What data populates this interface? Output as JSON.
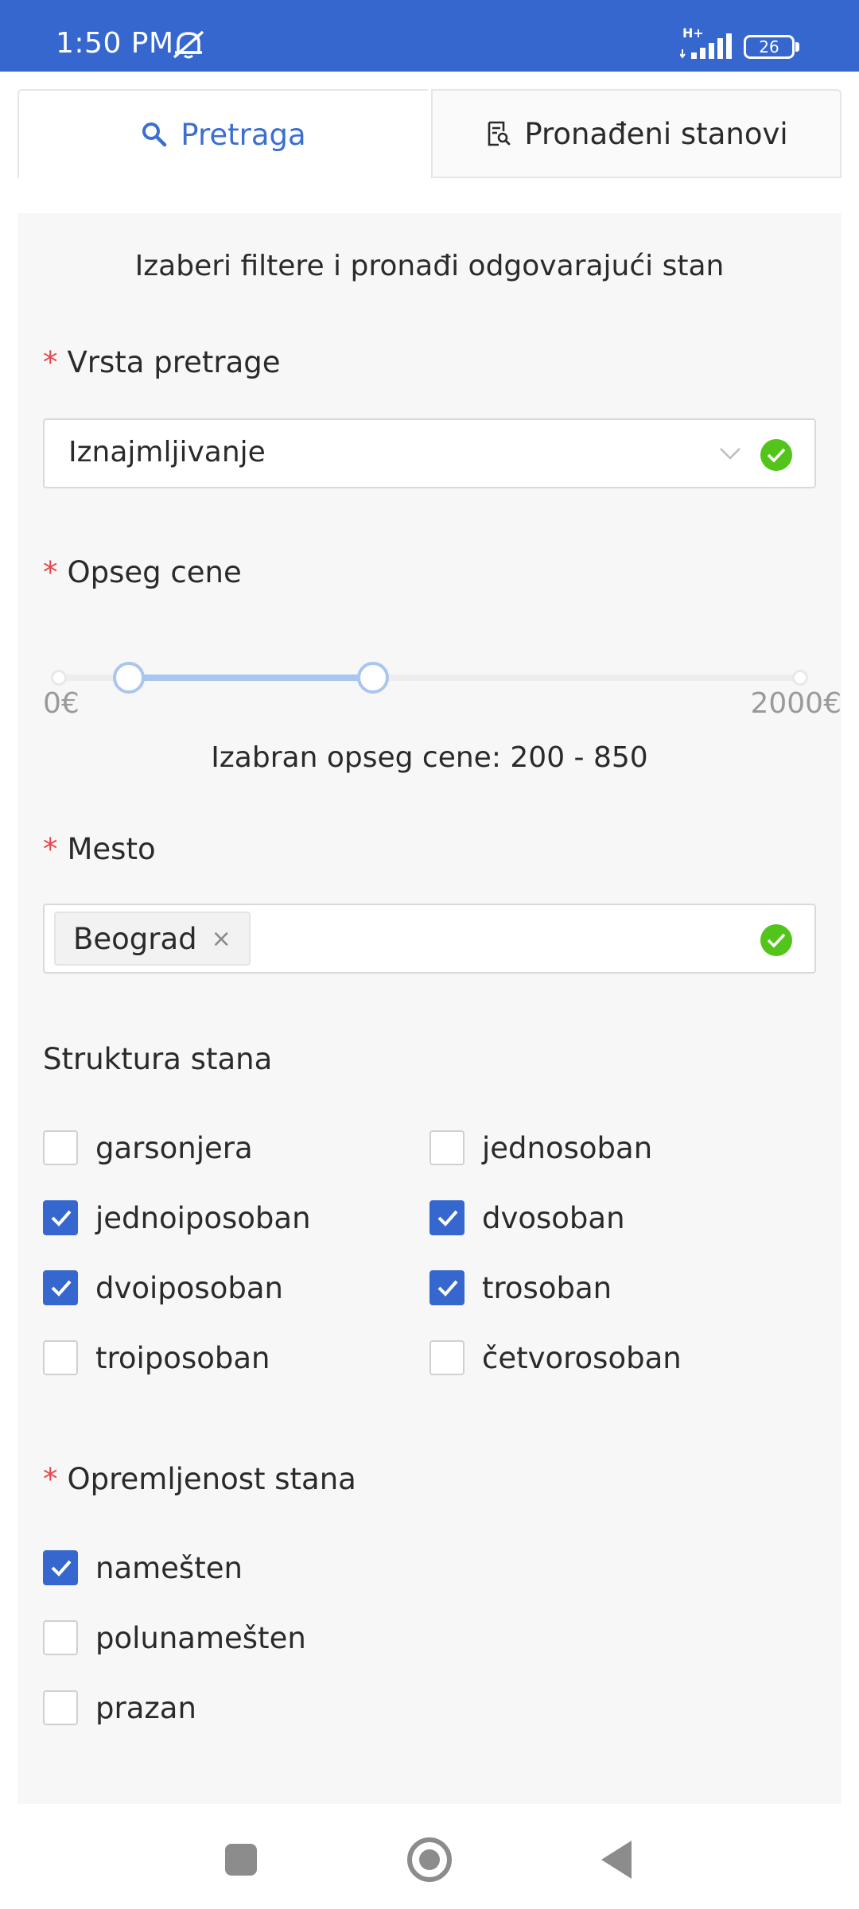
{
  "status_bar": {
    "time": "1:50 PM",
    "network": "H+",
    "battery": "26",
    "bg_color": "#3567cf"
  },
  "tabs": [
    {
      "label": "Pretraga",
      "icon": "search-icon",
      "active": true
    },
    {
      "label": "Pronađeni stanovi",
      "icon": "document-search-icon",
      "active": false
    }
  ],
  "form": {
    "intro": "Izaberi filtere i pronađi odgovarajući stan",
    "search_type": {
      "required": "*",
      "label": "Vrsta pretrage",
      "value": "Iznajmljivanje"
    },
    "price": {
      "required": "*",
      "label": "Opseg cene",
      "min_label": "0€",
      "max_label": "2000€",
      "range_text": "Izabran opseg cene: 200 - 850",
      "min": 0,
      "max": 2000,
      "selected_low": 200,
      "selected_high": 850
    },
    "place": {
      "required": "*",
      "label": "Mesto",
      "tag": "Beograd",
      "tag_close": "×"
    },
    "structure": {
      "label": "Struktura stana",
      "options": [
        {
          "label": "garsonjera",
          "checked": false
        },
        {
          "label": "jednosoban",
          "checked": false
        },
        {
          "label": "jednoiposoban",
          "checked": true
        },
        {
          "label": "dvosoban",
          "checked": true
        },
        {
          "label": "dvoiposoban",
          "checked": true
        },
        {
          "label": "trosoban",
          "checked": true
        },
        {
          "label": "troiposoban",
          "checked": false
        },
        {
          "label": "četvorosoban",
          "checked": false
        }
      ]
    },
    "furnishing": {
      "required": "*",
      "label": "Opremljenost stana",
      "options": [
        {
          "label": "namešten",
          "checked": true
        },
        {
          "label": "polunamešten",
          "checked": false
        },
        {
          "label": "prazan",
          "checked": false
        }
      ]
    }
  },
  "colors": {
    "accent": "#3567cf",
    "success": "#52c41a",
    "required": "#e5484d"
  }
}
